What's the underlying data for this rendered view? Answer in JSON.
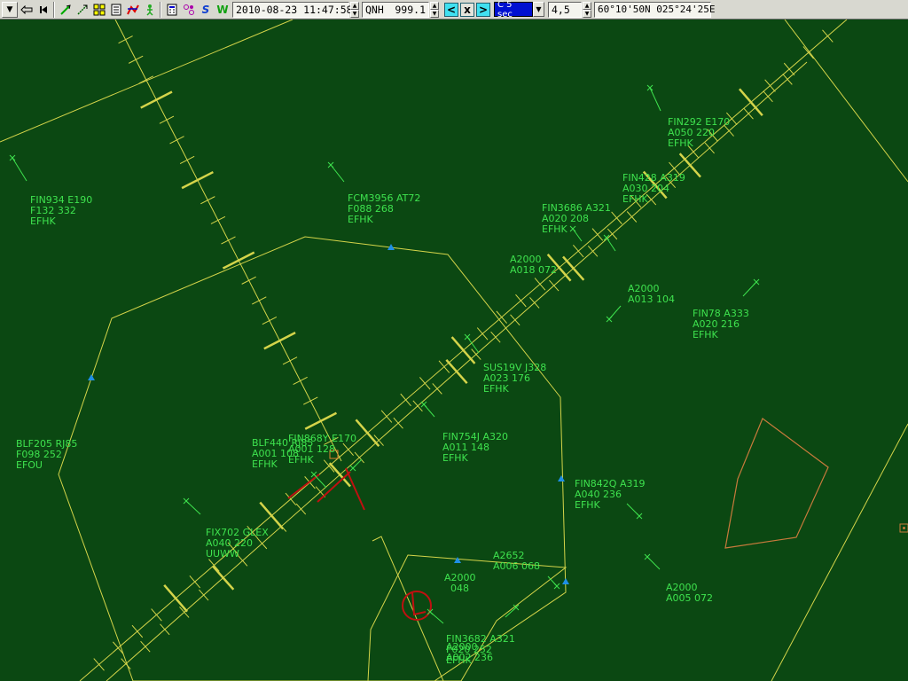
{
  "toolbar": {
    "datetime": "2010-08-23 11:47:58",
    "qnh_label": "QNH",
    "qnh_value": "999.1",
    "update_rate": "C 5 sec",
    "range": "4,5",
    "coordinates": "60°10'50N 025°24'25E",
    "icons": [
      "menu-arrow-icon",
      "recenter-icon",
      "first-icon",
      "vector-icon",
      "vector-up-icon",
      "grid-icon",
      "list-icon",
      "route-icon",
      "figure-icon",
      "calculator-icon",
      "node-icon",
      "s-letter-icon",
      "w-letter-icon"
    ],
    "s_label": "S",
    "w_label": "W",
    "prev_label": "<",
    "stop_label": "x",
    "next_label": ">"
  },
  "colors": {
    "background": "#0b4812",
    "label": "#3ee24e",
    "map": "#d4d44a",
    "restricted": "#c87a3c",
    "warning": "#d01010",
    "marker": "#1f8fe6"
  },
  "aircraft": [
    {
      "id": "fin934",
      "lines": [
        "FIN934 E190",
        "F132 332",
        "EFHK"
      ]
    },
    {
      "id": "fcm3956",
      "lines": [
        "FCM3956 AT72",
        "F088 268",
        "EFHK"
      ]
    },
    {
      "id": "fin292",
      "lines": [
        "FIN292 E170",
        "A050 220",
        "EFHK"
      ]
    },
    {
      "id": "fin428",
      "lines": [
        "FIN428 A319",
        "A030 204",
        "EFHK"
      ]
    },
    {
      "id": "fin3686",
      "lines": [
        "FIN3686 A321",
        "A020 208",
        "EFHK"
      ]
    },
    {
      "id": "a2000a",
      "lines": [
        "A2000",
        "A018 072"
      ]
    },
    {
      "id": "a2000b",
      "lines": [
        "A2000",
        "A013 104"
      ]
    },
    {
      "id": "fin78",
      "lines": [
        "FIN78 A333",
        "A020 216",
        "EFHK"
      ]
    },
    {
      "id": "sus19v",
      "lines": [
        "SUS19V J328",
        "A023 176",
        "EFHK"
      ]
    },
    {
      "id": "blf205",
      "lines": [
        "BLF205 RJ85",
        "F098 252",
        "EFOU"
      ]
    },
    {
      "id": "blf440",
      "lines": [
        "BLF440 RJ85",
        "A001 108",
        "EFHK"
      ]
    },
    {
      "id": "fin868y",
      "lines": [
        "FIN868Y E170",
        "A001 128",
        "EFHK"
      ]
    },
    {
      "id": "fin754j",
      "lines": [
        "FIN754J A320",
        "A011 148",
        "EFHK"
      ]
    },
    {
      "id": "fin842q",
      "lines": [
        "FIN842Q A319",
        "A040 236",
        "EFHK"
      ]
    },
    {
      "id": "fix702",
      "lines": [
        "FIX702 GLEX",
        "A040 220",
        "UUWW"
      ]
    },
    {
      "id": "a2652",
      "lines": [
        "A2652",
        "A006 068"
      ]
    },
    {
      "id": "a2000c",
      "lines": [
        "A2000",
        "  048"
      ]
    },
    {
      "id": "a2000d",
      "lines": [
        "A2000",
        "A005 072"
      ]
    },
    {
      "id": "fin3682",
      "lines": [
        "FIN3682 A321",
        "F020 252",
        "EFHK"
      ]
    },
    {
      "id": "hidden",
      "lines": [
        "A2000",
        "A002 236"
      ]
    }
  ]
}
